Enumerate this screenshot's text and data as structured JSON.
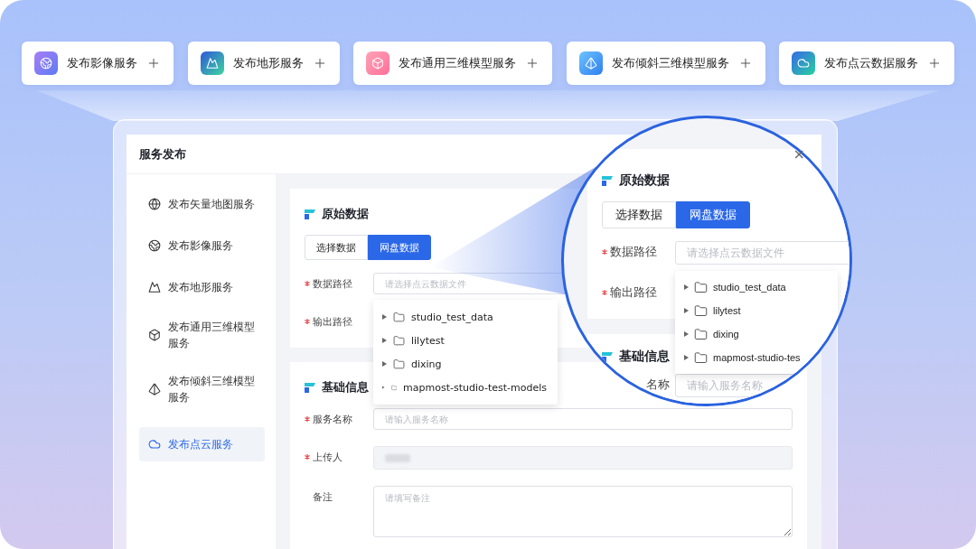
{
  "service_cards": [
    {
      "label": "发布影像服务",
      "kind": "globe"
    },
    {
      "label": "发布地形服务",
      "kind": "terrain"
    },
    {
      "label": "发布通用三维模型服务",
      "kind": "cube"
    },
    {
      "label": "发布倾斜三维模型服务",
      "kind": "pyramid"
    },
    {
      "label": "发布点云数据服务",
      "kind": "cloud"
    }
  ],
  "dialog": {
    "title": "服务发布",
    "close": "×"
  },
  "sidebar": {
    "items": [
      {
        "label": "发布矢量地图服务",
        "kind": "grid-globe",
        "selected": false
      },
      {
        "label": "发布影像服务",
        "kind": "globe",
        "selected": false
      },
      {
        "label": "发布地形服务",
        "kind": "terrain",
        "selected": false
      },
      {
        "label": "发布通用三维模型服务",
        "kind": "cube",
        "selected": false
      },
      {
        "label": "发布倾斜三维模型服务",
        "kind": "pyramid",
        "selected": false
      },
      {
        "label": "发布点云服务",
        "kind": "cloud",
        "selected": true
      }
    ]
  },
  "source_section": {
    "title": "原始数据",
    "tabs": [
      {
        "label": "选择数据",
        "selected": false
      },
      {
        "label": "网盘数据",
        "selected": true
      }
    ],
    "fields": [
      {
        "label": "数据路径",
        "required": true,
        "placeholder": "请选择点云数据文件"
      },
      {
        "label": "输出路径",
        "required": true
      }
    ],
    "tree_popup": {
      "items": [
        "studio_test_data",
        "lilytest",
        "dixing",
        "mapmost-studio-test-models"
      ]
    }
  },
  "basic_section": {
    "title": "基础信息",
    "fields": [
      {
        "label": "服务名称",
        "required": true,
        "kind": "input",
        "placeholder": "请输入服务名称"
      },
      {
        "label": "上传人",
        "required": true,
        "kind": "readonly"
      },
      {
        "label": "备注",
        "required": false,
        "kind": "textarea",
        "placeholder": "请填写备注"
      }
    ]
  },
  "magnifier": {
    "title": "原始数据",
    "tabs": [
      {
        "label": "选择数据",
        "selected": false
      },
      {
        "label": "网盘数据",
        "selected": true
      }
    ],
    "fields": [
      {
        "label": "数据路径",
        "required": true,
        "placeholder": "请选择点云数据文件"
      },
      {
        "label": "输出路径",
        "required": true
      }
    ],
    "tree_items": [
      "studio_test_data",
      "lilytest",
      "dixing",
      "mapmost-studio-tes"
    ],
    "title_2": "基础信息",
    "field_2": {
      "label": "名称",
      "placeholder": "请输入服务名称"
    }
  }
}
